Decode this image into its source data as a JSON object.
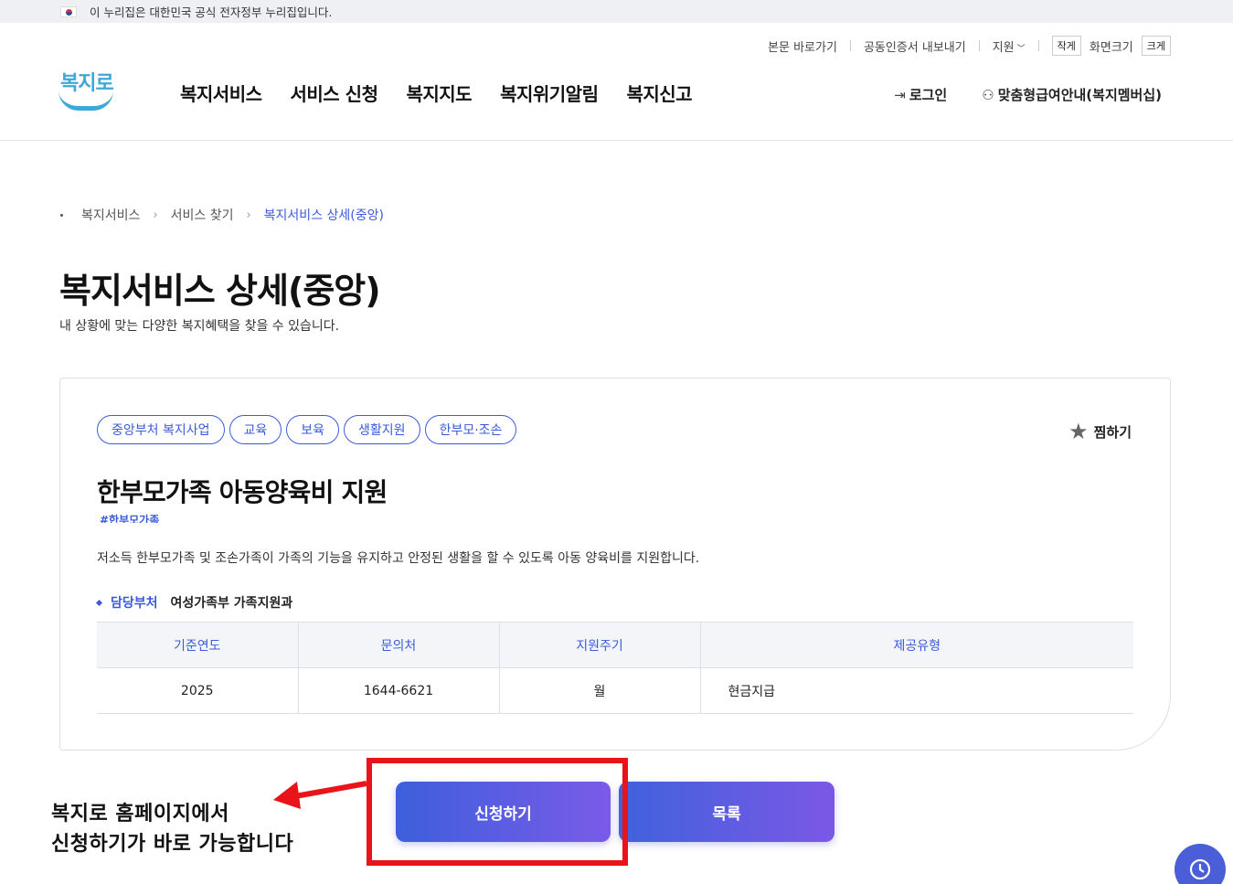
{
  "gov_banner": {
    "text": "이 누리집은 대한민국 공식 전자정부 누리집입니다."
  },
  "utility": {
    "skip": "본문 바로가기",
    "cert": "공동인증서 내보내기",
    "support": "지원",
    "small": "작게",
    "font_size": "화면크기",
    "large": "크게"
  },
  "logo": {
    "text": "복지로"
  },
  "gnb": [
    "복지서비스",
    "서비스 신청",
    "복지지도",
    "복지위기알림",
    "복지신고"
  ],
  "gnb_right": {
    "login": "로그인",
    "membership": "맞춤형급여안내(복지멤버십)"
  },
  "breadcrumb": [
    "복지서비스",
    "서비스 찾기",
    "복지서비스 상세(중앙)"
  ],
  "page": {
    "title": "복지서비스 상세(중앙)",
    "subtitle": "내 상황에 맞는 다양한 복지혜택을 찾을 수 있습니다."
  },
  "service": {
    "tags": [
      "중앙부처 복지사업",
      "교육",
      "보육",
      "생활지원",
      "한부모·조손"
    ],
    "favorite": "찜하기",
    "title": "한부모가족 아동양육비 지원",
    "hashtag": "#한부모가족",
    "description": "저소득 한부모가족 및 조손가족이 가족의 기능을 유지하고 안정된 생활을 할 수 있도록 아동 양육비를 지원합니다.",
    "dept_label": "담당부처",
    "dept_value": "여성가족부 가족지원과",
    "table": {
      "headers": [
        "기준연도",
        "문의처",
        "지원주기",
        "제공유형"
      ],
      "row": [
        "2025",
        "1644-6621",
        "월",
        "현금지급"
      ]
    }
  },
  "buttons": {
    "apply": "신청하기",
    "list": "목록"
  },
  "annotation": {
    "line1": "복지로 홈페이지에서",
    "line2": "신청하기가 바로 가능합니다"
  },
  "colors": {
    "accent": "#3b5bdb",
    "highlight": "#e8141a"
  }
}
